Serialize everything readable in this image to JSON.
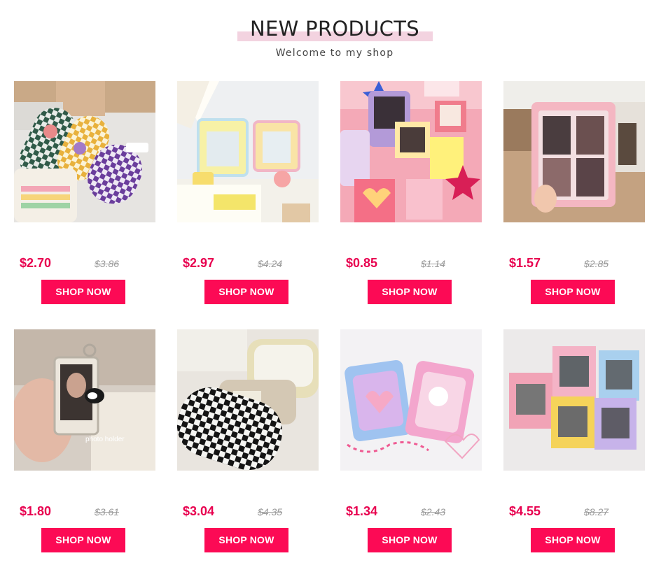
{
  "section": {
    "title": "NEW PRODUCTS",
    "subtitle": "Welcome to my shop",
    "accent_color": "#fc0a55",
    "title_highlight_color": "#f3d3e0"
  },
  "products": [
    {
      "price": "$2.70",
      "original_price": "$3.86",
      "button": "SHOP NOW"
    },
    {
      "price": "$2.97",
      "original_price": "$4.24",
      "button": "SHOP NOW"
    },
    {
      "price": "$0.85",
      "original_price": "$1.14",
      "button": "SHOP NOW"
    },
    {
      "price": "$1.57",
      "original_price": "$2.85",
      "button": "SHOP NOW"
    },
    {
      "price": "$1.80",
      "original_price": "$3.61",
      "button": "SHOP NOW",
      "image_caption": "photo holder"
    },
    {
      "price": "$3.04",
      "original_price": "$4.35",
      "button": "SHOP NOW"
    },
    {
      "price": "$1.34",
      "original_price": "$2.43",
      "button": "SHOP NOW"
    },
    {
      "price": "$4.55",
      "original_price": "$8.27",
      "button": "SHOP NOW"
    }
  ]
}
